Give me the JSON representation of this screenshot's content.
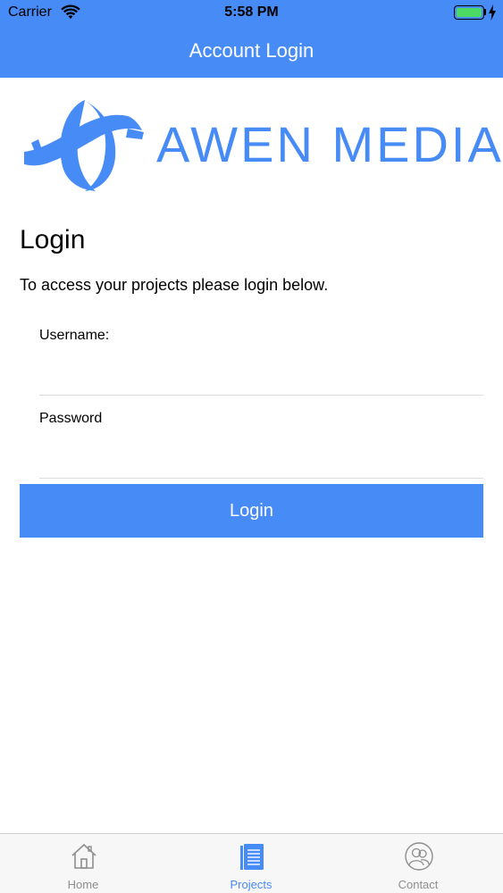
{
  "status_bar": {
    "carrier": "Carrier",
    "time": "5:58 PM",
    "battery_color": "#4cd964"
  },
  "nav": {
    "title": "Account Login",
    "color": "#478bf7"
  },
  "logo": {
    "text": "AWEN MEDIA",
    "icon": "awen-media-logo-mark"
  },
  "main": {
    "heading": "Login",
    "description": "To access your projects please login below.",
    "username_label": "Username:",
    "username_value": "",
    "password_label": "Password",
    "password_value": "",
    "login_button": "Login"
  },
  "tab_bar": {
    "tabs": [
      {
        "label": "Home",
        "icon": "house-icon",
        "active": false
      },
      {
        "label": "Projects",
        "icon": "document-icon",
        "active": true
      },
      {
        "label": "Contact",
        "icon": "contacts-icon",
        "active": false
      }
    ]
  }
}
